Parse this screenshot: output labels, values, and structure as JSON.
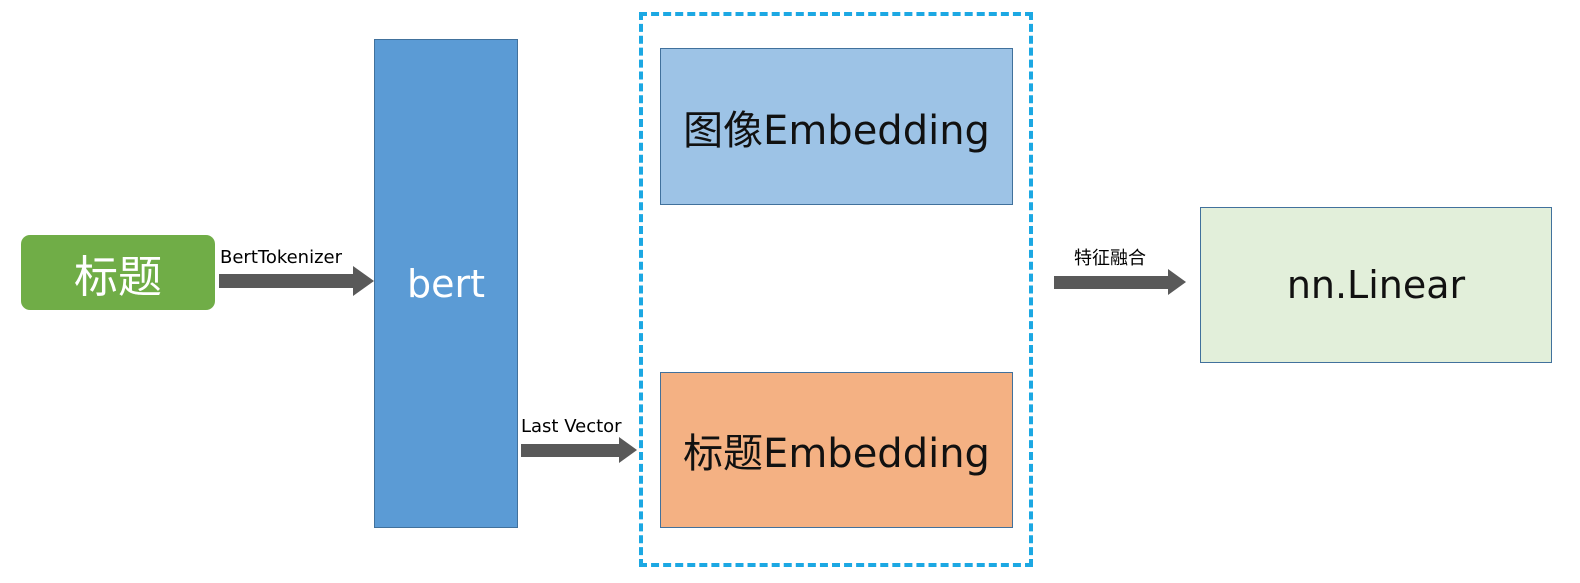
{
  "nodes": {
    "title_input": "标题",
    "bert": "bert",
    "image_embedding": "图像Embedding",
    "title_embedding": "标题Embedding",
    "linear": "nn.Linear"
  },
  "edges": {
    "tokenizer": "BertTokenizer",
    "last_vector": "Last Vector",
    "fusion": "特征融合"
  },
  "colors": {
    "title_input": "#70AD47",
    "bert": "#5B9BD5",
    "image_embedding": "#9DC3E6",
    "title_embedding": "#F4B183",
    "linear": "#E2EFDA",
    "dashed_border": "#1CA8E3",
    "arrow": "#595959"
  }
}
